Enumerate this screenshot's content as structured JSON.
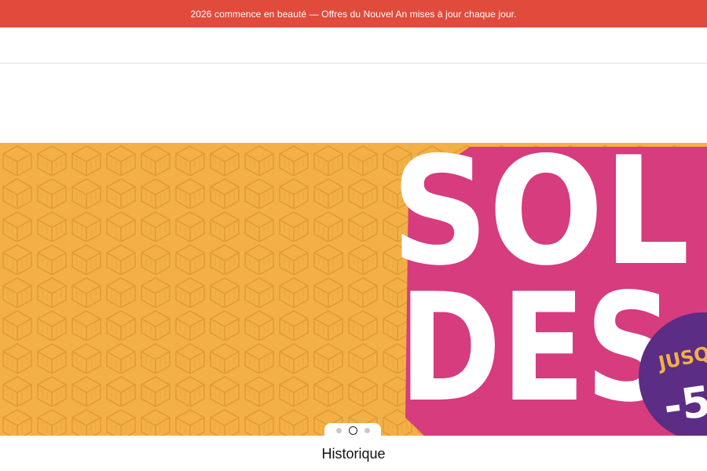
{
  "announcement": {
    "text": "2026 commence en beauté — Offres du Nouvel An mises à jour chaque jour."
  },
  "hero": {
    "headline_line1": "SOL",
    "headline_line2": "DES",
    "badge_top": "JUSQU",
    "badge_bottom": "-5",
    "colors": {
      "background": "#f2b046",
      "pattern": "#e9a63c",
      "shadow": "#d63c7e",
      "text": "#ffffff",
      "badge": "#5b2d84",
      "badge_text": "#f2b046"
    }
  },
  "carousel": {
    "slides_count": 3,
    "active_index": 1
  },
  "section": {
    "title": "Historique"
  }
}
